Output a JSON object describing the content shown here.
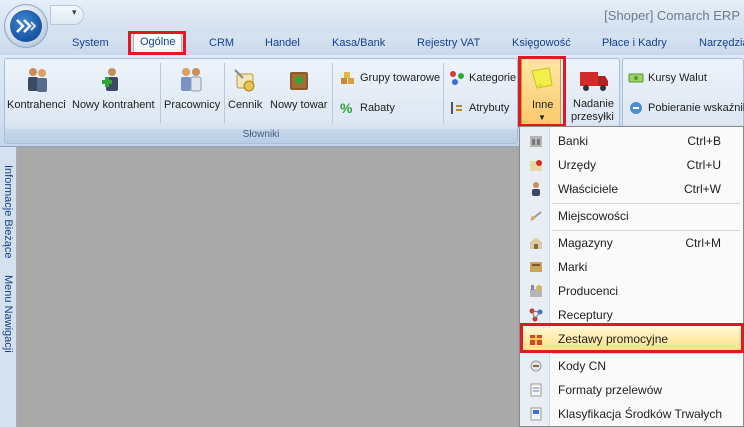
{
  "window": {
    "title": "[Shoper] Comarch ERP"
  },
  "qat": {
    "arrow": "▾"
  },
  "tabs": [
    {
      "label": "System"
    },
    {
      "label": "Ogólne"
    },
    {
      "label": "CRM"
    },
    {
      "label": "Handel"
    },
    {
      "label": "Kasa/Bank"
    },
    {
      "label": "Rejestry VAT"
    },
    {
      "label": "Księgowość"
    },
    {
      "label": "Płace i Kadry"
    },
    {
      "label": "Narzędzia"
    }
  ],
  "ribbon": {
    "group_label": "Słowniki",
    "buttons": {
      "kontrahenci": "Kontrahenci",
      "nowy_kontrahent": "Nowy kontrahent",
      "pracownicy": "Pracownicy",
      "cennik": "Cennik",
      "nowy_towar": "Nowy towar",
      "grupy_towarowe": "Grupy towarowe",
      "rabaty": "Rabaty",
      "kategorie": "Kategorie",
      "atrybuty": "Atrybuty",
      "inne": "Inne",
      "nadanie_line1": "Nadanie",
      "nadanie_line2": "przesyłki",
      "kursy_walut": "Kursy Walut",
      "pobieranie": "Pobieranie wskaźnik"
    }
  },
  "leftbar": {
    "informacje": "Informacje Bieżące",
    "menu": "Menu Nawigacji"
  },
  "dropdown": {
    "items": [
      {
        "label": "Banki",
        "shortcut": "Ctrl+B"
      },
      {
        "label": "Urzędy",
        "shortcut": "Ctrl+U"
      },
      {
        "label": "Właściciele",
        "shortcut": "Ctrl+W"
      },
      {
        "label": "Miejscowości",
        "shortcut": ""
      },
      {
        "label": "Magazyny",
        "shortcut": "Ctrl+M"
      },
      {
        "label": "Marki",
        "shortcut": ""
      },
      {
        "label": "Producenci",
        "shortcut": ""
      },
      {
        "label": "Receptury",
        "shortcut": ""
      },
      {
        "label": "Zestawy promocyjne",
        "shortcut": ""
      },
      {
        "label": "Kody CN",
        "shortcut": ""
      },
      {
        "label": "Formaty przelewów",
        "shortcut": ""
      },
      {
        "label": "Klasyfikacja Środków Trwałych",
        "shortcut": ""
      }
    ]
  },
  "colors": {
    "highlight_outline": "#e01a22",
    "tab_text": "#15428b",
    "workspace": "#a9a9a9"
  }
}
